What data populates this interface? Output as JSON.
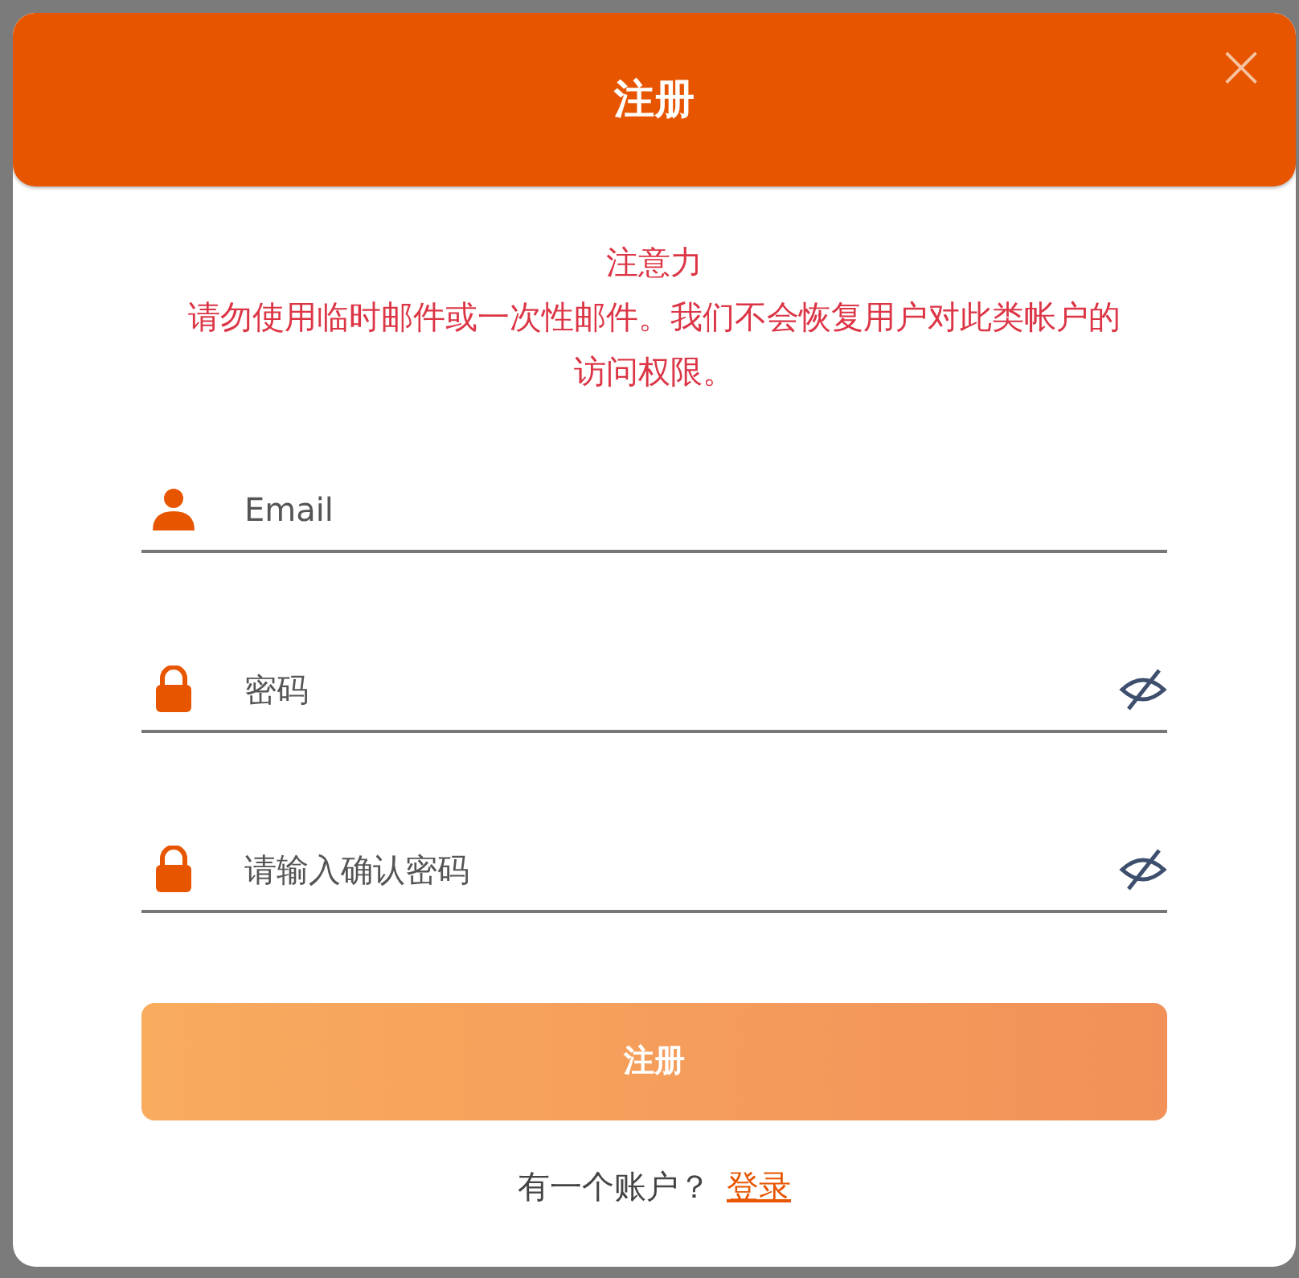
{
  "dialog": {
    "title": "注册",
    "close": "×"
  },
  "notice": {
    "heading": "注意力",
    "text": "请勿使用临时邮件或一次性邮件。我们不会恢复用户对此类帐户的访问权限。"
  },
  "fields": [
    {
      "kind": "email",
      "placeholder": "Email"
    },
    {
      "kind": "password",
      "placeholder": "密码",
      "visible": false
    },
    {
      "kind": "password",
      "placeholder": "请输入确认密码",
      "visible": false
    }
  ],
  "submit": "注册",
  "footer": {
    "prompt": "有一个账户？",
    "link": "登录"
  }
}
